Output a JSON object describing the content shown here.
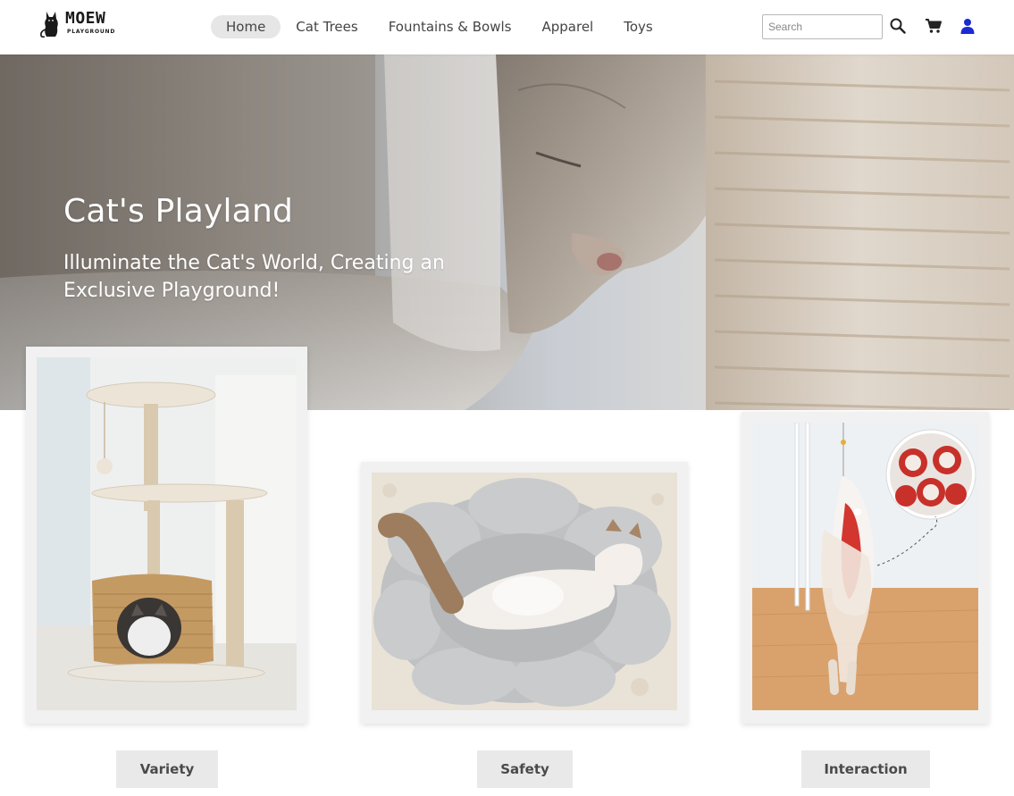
{
  "brand": {
    "name": "MOEW",
    "tagline": "PLAYGROUND"
  },
  "nav": {
    "items": [
      {
        "label": "Home",
        "active": true
      },
      {
        "label": "Cat Trees",
        "active": false
      },
      {
        "label": "Fountains & Bowls",
        "active": false
      },
      {
        "label": "Apparel",
        "active": false
      },
      {
        "label": "Toys",
        "active": false
      }
    ]
  },
  "search": {
    "placeholder": "Search",
    "value": ""
  },
  "header_icons": [
    "search-icon",
    "cart-icon",
    "user-icon"
  ],
  "hero": {
    "title": "Cat's Playland",
    "subtitle": "Illuminate the Cat's World, Creating an Exclusive Playground!"
  },
  "features": [
    {
      "label": "Variety",
      "image": "cat tree with cat in wicker house"
    },
    {
      "label": "Safety",
      "image": "cat lying in grey flower-shaped bed"
    },
    {
      "label": "Interaction",
      "image": "cat playing with hanging koi fish toy"
    }
  ],
  "colors": {
    "accent_user_icon": "#1a2ad6",
    "nav_active_bg": "#e6e6e6",
    "button_bg": "#e9e9e9",
    "card_bg": "#f1f1f1"
  }
}
